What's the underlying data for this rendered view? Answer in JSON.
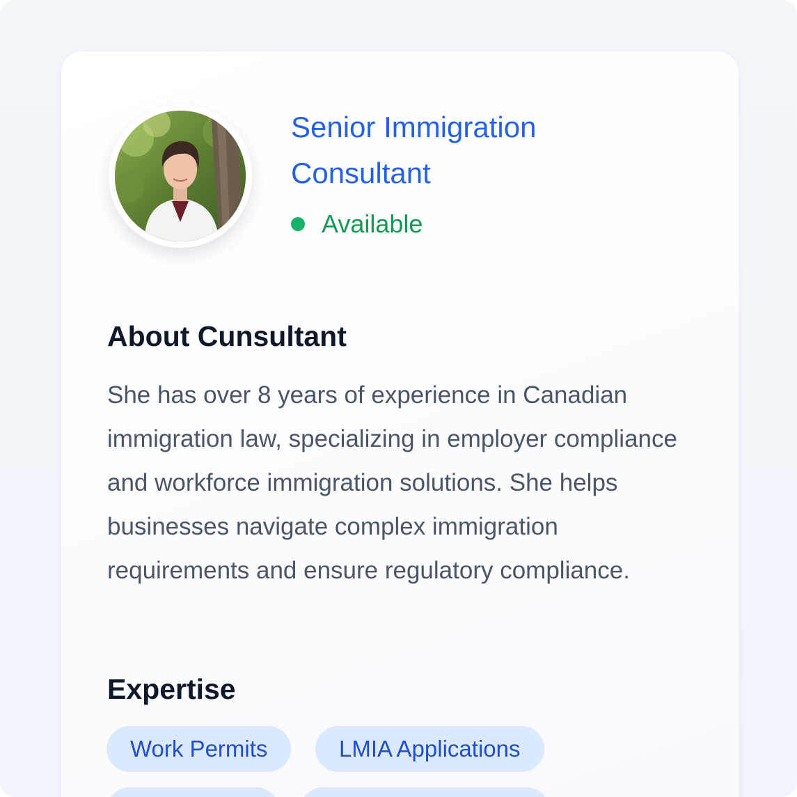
{
  "consultant": {
    "title": "Senior Immigration Consultant",
    "status": "Available",
    "status_color": "#17b26a",
    "avatar_icon": "consultant-photo"
  },
  "about": {
    "heading": "About Cunsultant",
    "text": "She has over 8 years of experience in Canadian immigration law, specializing in employer compliance and workforce immigration solutions. She helps businesses navigate complex immigration requirements and ensure regulatory compliance."
  },
  "expertise": {
    "heading": "Expertise",
    "tags": [
      {
        "label": "Work Permits"
      },
      {
        "label": "LMIA Applications"
      },
      {
        "label": ""
      },
      {
        "label": ""
      }
    ]
  },
  "colors": {
    "accent": "#2461e8",
    "tag_background": "#dbe8fd",
    "tag_text": "#1f4fd1",
    "heading": "#0f172a",
    "body_text": "#4b5567"
  }
}
